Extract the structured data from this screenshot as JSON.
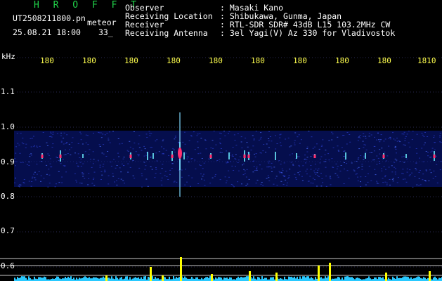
{
  "header": {
    "title": "H R O F F T",
    "file_name": "UT2508211800.pn",
    "mode": "meteor",
    "datetime": "25.08.21 18:00",
    "count": "33_",
    "fields": [
      {
        "label": "Observer",
        "value": ": Masaki Kano"
      },
      {
        "label": "Receiving Location",
        "value": ": Shibukawa, Gunma, Japan"
      },
      {
        "label": "Receiver",
        "value": ": RTL-SDR SDR# 43dB L15 103.2MHz CW"
      },
      {
        "label": "Receiving Antenna",
        "value": ": 3el Yagi(V) Az 330 for Vladivostok"
      }
    ]
  },
  "axes": {
    "y_unit": "kHz",
    "y_ticks": [
      "1.1",
      "1.0",
      "0.9",
      "0.8",
      "0.7",
      "0.6"
    ],
    "x_ticks": [
      "180",
      "180",
      "180",
      "180",
      "180",
      "180",
      "180",
      "180",
      "180",
      "1810"
    ]
  },
  "colors": {
    "title": "#21d44a",
    "text": "#ffffff",
    "x_tick": "#ffff4d",
    "band": "#0a1a8c",
    "signal": "#ff3070",
    "level_fill": "#29c9ff",
    "level_peak": "#ffff00"
  }
}
